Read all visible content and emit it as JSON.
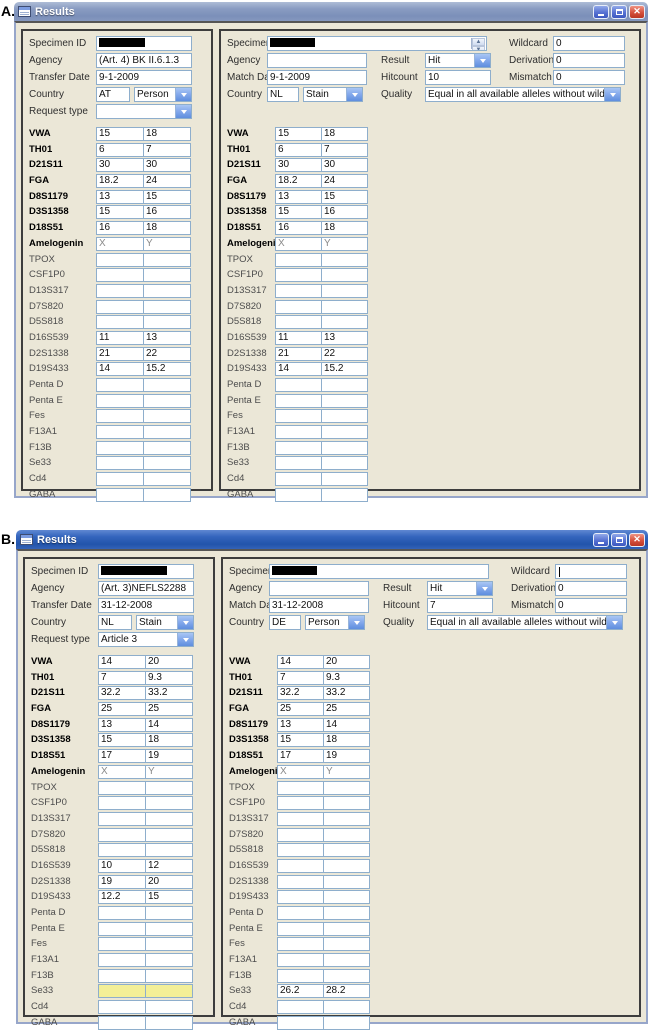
{
  "figure_labels": {
    "a": "A.",
    "b": "B."
  },
  "labels": {
    "specimen_id": "Specimen ID",
    "agency": "Agency",
    "transfer_date": "Transfer Date",
    "match_date": "Match Date",
    "country": "Country",
    "request_type": "Request type",
    "result": "Result",
    "hitcount": "Hitcount",
    "quality": "Quality",
    "wildcard": "Wildcard",
    "derivation": "Derivation",
    "mismatch": "Mismatch"
  },
  "colors": {
    "client_background": "#ebe7d7",
    "titlebar_active": "#2254ab",
    "titlebar_inactive": "#8a9cc2",
    "field_border": "#8eaecc",
    "highlight_yellow": "#f3ef97",
    "close_button_red": "#d6503c"
  },
  "windows": [
    {
      "title": "Results",
      "request": {
        "specimen_id_redacted": true,
        "agency": "(Art. 4) BK II.6.1.3",
        "transfer_date": "9-1-2009",
        "country_code": "AT",
        "country_type": "Person",
        "request_type": "",
        "loci": [
          {
            "n": "VWA",
            "b": 1,
            "v1": "15",
            "v2": "18"
          },
          {
            "n": "TH01",
            "b": 1,
            "v1": "6",
            "v2": "7"
          },
          {
            "n": "D21S11",
            "b": 1,
            "v1": "30",
            "v2": "30"
          },
          {
            "n": "FGA",
            "b": 1,
            "v1": "18.2",
            "v2": "24"
          },
          {
            "n": "D8S1179",
            "b": 1,
            "v1": "13",
            "v2": "15"
          },
          {
            "n": "D3S1358",
            "b": 1,
            "v1": "15",
            "v2": "16"
          },
          {
            "n": "D18S51",
            "b": 1,
            "v1": "16",
            "v2": "18"
          },
          {
            "n": "Amelogenin",
            "b": 1,
            "v1": "X",
            "v2": "Y",
            "g": 1
          },
          {
            "n": "TPOX"
          },
          {
            "n": "CSF1P0"
          },
          {
            "n": "D13S317"
          },
          {
            "n": "D7S820"
          },
          {
            "n": "D5S818"
          },
          {
            "n": "D16S539",
            "v1": "11",
            "v2": "13"
          },
          {
            "n": "D2S1338",
            "v1": "21",
            "v2": "22"
          },
          {
            "n": "D19S433",
            "v1": "14",
            "v2": "15.2"
          },
          {
            "n": "Penta D"
          },
          {
            "n": "Penta E"
          },
          {
            "n": "Fes"
          },
          {
            "n": "F13A1"
          },
          {
            "n": "F13B"
          },
          {
            "n": "Se33"
          },
          {
            "n": "Cd4"
          },
          {
            "n": "GABA"
          }
        ]
      },
      "match": {
        "specimen_id_redacted": true,
        "has_spinner": true,
        "agency": "",
        "match_date": "9-1-2009",
        "country_code": "NL",
        "country_type": "Stain",
        "result": "Hit",
        "hitcount": "10",
        "wildcard": "0",
        "derivation": "0",
        "mismatch": "0",
        "quality": "Equal in all available alleles without wildcards",
        "loci": [
          {
            "n": "VWA",
            "b": 1,
            "v1": "15",
            "v2": "18"
          },
          {
            "n": "TH01",
            "b": 1,
            "v1": "6",
            "v2": "7"
          },
          {
            "n": "D21S11",
            "b": 1,
            "v1": "30",
            "v2": "30"
          },
          {
            "n": "FGA",
            "b": 1,
            "v1": "18.2",
            "v2": "24"
          },
          {
            "n": "D8S1179",
            "b": 1,
            "v1": "13",
            "v2": "15"
          },
          {
            "n": "D3S1358",
            "b": 1,
            "v1": "15",
            "v2": "16"
          },
          {
            "n": "D18S51",
            "b": 1,
            "v1": "16",
            "v2": "18"
          },
          {
            "n": "Amelogenin",
            "b": 1,
            "v1": "X",
            "v2": "Y",
            "g": 1
          },
          {
            "n": "TPOX"
          },
          {
            "n": "CSF1P0"
          },
          {
            "n": "D13S317"
          },
          {
            "n": "D7S820"
          },
          {
            "n": "D5S818"
          },
          {
            "n": "D16S539",
            "v1": "11",
            "v2": "13"
          },
          {
            "n": "D2S1338",
            "v1": "21",
            "v2": "22"
          },
          {
            "n": "D19S433",
            "v1": "14",
            "v2": "15.2"
          },
          {
            "n": "Penta D"
          },
          {
            "n": "Penta E"
          },
          {
            "n": "Fes"
          },
          {
            "n": "F13A1"
          },
          {
            "n": "F13B"
          },
          {
            "n": "Se33"
          },
          {
            "n": "Cd4"
          },
          {
            "n": "GABA"
          }
        ]
      }
    },
    {
      "title": "Results",
      "request": {
        "specimen_id_redacted": true,
        "agency": "(Art. 3)NEFLS2288",
        "transfer_date": "31-12-2008",
        "country_code": "NL",
        "country_type": "Stain",
        "request_type": "Article 3",
        "loci": [
          {
            "n": "VWA",
            "b": 1,
            "v1": "14",
            "v2": "20"
          },
          {
            "n": "TH01",
            "b": 1,
            "v1": "7",
            "v2": "9.3"
          },
          {
            "n": "D21S11",
            "b": 1,
            "v1": "32.2",
            "v2": "33.2"
          },
          {
            "n": "FGA",
            "b": 1,
            "v1": "25",
            "v2": "25"
          },
          {
            "n": "D8S1179",
            "b": 1,
            "v1": "13",
            "v2": "14"
          },
          {
            "n": "D3S1358",
            "b": 1,
            "v1": "15",
            "v2": "18"
          },
          {
            "n": "D18S51",
            "b": 1,
            "v1": "17",
            "v2": "19"
          },
          {
            "n": "Amelogenin",
            "b": 1,
            "v1": "X",
            "v2": "Y",
            "g": 1
          },
          {
            "n": "TPOX"
          },
          {
            "n": "CSF1P0"
          },
          {
            "n": "D13S317"
          },
          {
            "n": "D7S820"
          },
          {
            "n": "D5S818"
          },
          {
            "n": "D16S539",
            "v1": "10",
            "v2": "12"
          },
          {
            "n": "D2S1338",
            "v1": "19",
            "v2": "20"
          },
          {
            "n": "D19S433",
            "v1": "12.2",
            "v2": "15"
          },
          {
            "n": "Penta D"
          },
          {
            "n": "Penta E"
          },
          {
            "n": "Fes"
          },
          {
            "n": "F13A1"
          },
          {
            "n": "F13B"
          },
          {
            "n": "Se33",
            "hl": 1
          },
          {
            "n": "Cd4"
          },
          {
            "n": "GABA"
          }
        ]
      },
      "match": {
        "specimen_id_redacted": true,
        "text_cursor_in_wildcard": true,
        "agency": "",
        "match_date": "31-12-2008",
        "country_code": "DE",
        "country_type": "Person",
        "result": "Hit",
        "hitcount": "7",
        "wildcard": "",
        "derivation": "0",
        "mismatch": "0",
        "quality": "Equal in all available alleles without wildcards",
        "loci": [
          {
            "n": "VWA",
            "b": 1,
            "v1": "14",
            "v2": "20"
          },
          {
            "n": "TH01",
            "b": 1,
            "v1": "7",
            "v2": "9.3"
          },
          {
            "n": "D21S11",
            "b": 1,
            "v1": "32.2",
            "v2": "33.2"
          },
          {
            "n": "FGA",
            "b": 1,
            "v1": "25",
            "v2": "25"
          },
          {
            "n": "D8S1179",
            "b": 1,
            "v1": "13",
            "v2": "14"
          },
          {
            "n": "D3S1358",
            "b": 1,
            "v1": "15",
            "v2": "18"
          },
          {
            "n": "D18S51",
            "b": 1,
            "v1": "17",
            "v2": "19"
          },
          {
            "n": "Amelogenin",
            "b": 1,
            "v1": "X",
            "v2": "Y",
            "g": 1
          },
          {
            "n": "TPOX"
          },
          {
            "n": "CSF1P0"
          },
          {
            "n": "D13S317"
          },
          {
            "n": "D7S820"
          },
          {
            "n": "D5S818"
          },
          {
            "n": "D16S539"
          },
          {
            "n": "D2S1338"
          },
          {
            "n": "D19S433"
          },
          {
            "n": "Penta D"
          },
          {
            "n": "Penta E"
          },
          {
            "n": "Fes"
          },
          {
            "n": "F13A1"
          },
          {
            "n": "F13B"
          },
          {
            "n": "Se33",
            "v1": "26.2",
            "v2": "28.2"
          },
          {
            "n": "Cd4"
          },
          {
            "n": "GABA"
          }
        ]
      }
    }
  ]
}
